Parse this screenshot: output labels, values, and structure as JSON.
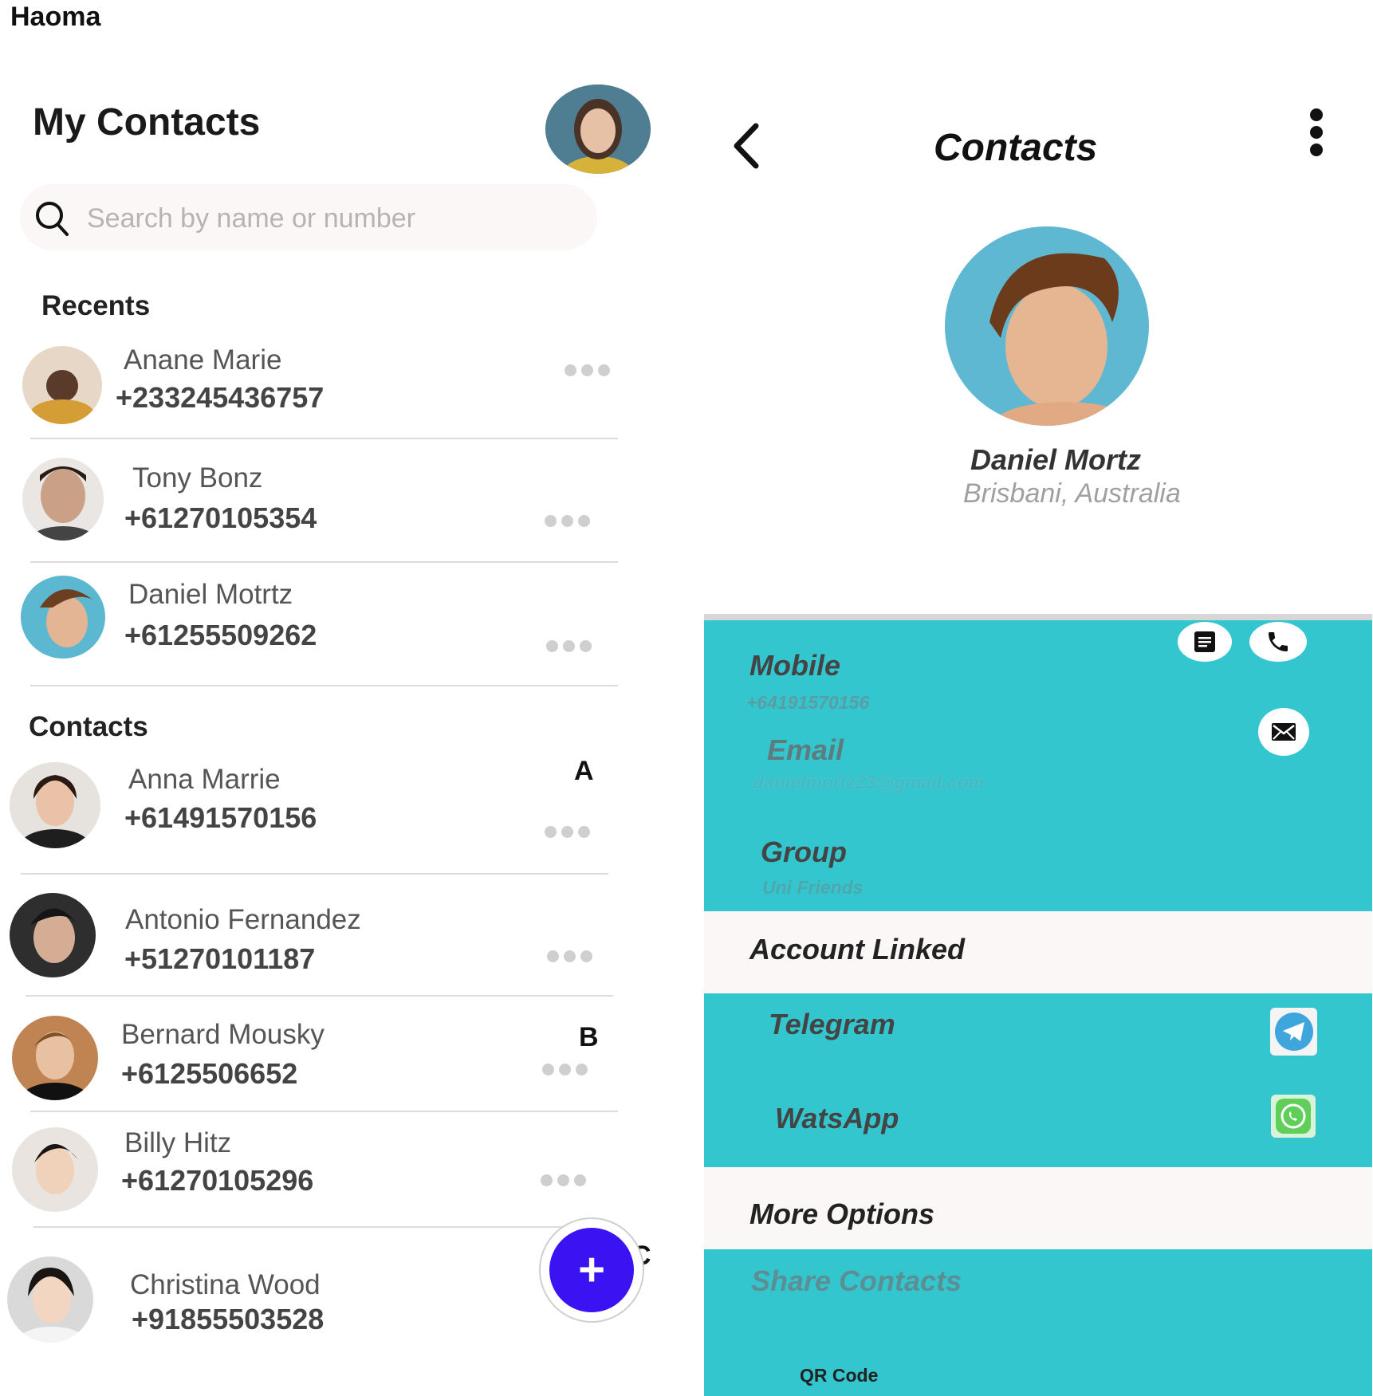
{
  "app": {
    "title": "Haoma"
  },
  "contacts_screen": {
    "title": "My Contacts",
    "search": {
      "placeholder": "Search by name or number",
      "value": ""
    },
    "recents_label": "Recents",
    "contacts_label": "Contacts",
    "recents": [
      {
        "name": "Anane Marie",
        "phone": "+233245436757"
      },
      {
        "name": "Tony Bonz",
        "phone": "+61270105354"
      },
      {
        "name": "Daniel Motrtz",
        "phone": "+61255509262"
      }
    ],
    "contacts": [
      {
        "name": "Anna Marrie",
        "phone": "+61491570156",
        "letter": "A"
      },
      {
        "name": "Antonio Fernandez",
        "phone": "+51270101187",
        "letter": ""
      },
      {
        "name": "Bernard Mousky",
        "phone": "+6125506652",
        "letter": "B"
      },
      {
        "name": "Billy Hitz",
        "phone": "+61270105296",
        "letter": ""
      },
      {
        "name": "Christina Wood",
        "phone": "+91855503528",
        "letter": "C"
      }
    ],
    "fab_label": "+"
  },
  "detail_screen": {
    "title": "Contacts",
    "name": "Daniel Mortz",
    "location": "Brisbani, Australia",
    "mobile": {
      "label": "Mobile",
      "value": "+64191570156"
    },
    "email": {
      "label": "Email",
      "value": "danielmortz23@gmail.com"
    },
    "group": {
      "label": "Group",
      "value": "Uni Friends"
    },
    "account_linked_label": "Account Linked",
    "linked_accounts": [
      {
        "label": "Telegram",
        "icon": "telegram-icon"
      },
      {
        "label": "WatsApp",
        "icon": "whatsapp-icon"
      }
    ],
    "more_options_label": "More Options",
    "share_contacts_label": "Share Contacts",
    "qr_code_label": "QR Code"
  },
  "colors": {
    "teal": "#34c6cf",
    "fab": "#3b12f2",
    "light_bg": "#faf7f6"
  }
}
